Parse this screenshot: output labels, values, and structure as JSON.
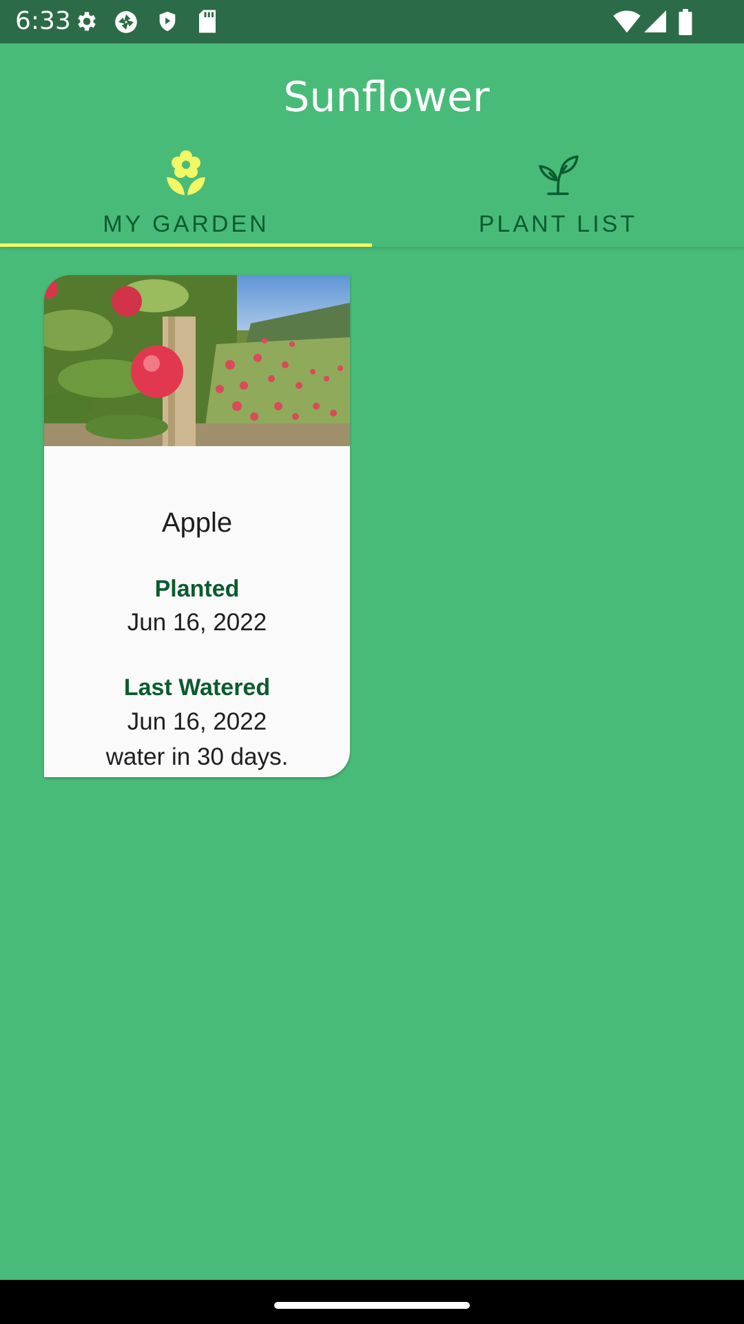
{
  "status_bar": {
    "time": "6:33",
    "left_icons": [
      "gear-icon",
      "aperture-icon",
      "shield-icon",
      "sd-card-icon"
    ],
    "right_icons": [
      "wifi-icon",
      "signal-icon",
      "battery-icon"
    ]
  },
  "app_bar": {
    "title": "Sunflower"
  },
  "tabs": [
    {
      "label": "MY GARDEN",
      "icon": "flower-icon",
      "selected": true
    },
    {
      "label": "PLANT LIST",
      "icon": "sprout-icon",
      "selected": false
    }
  ],
  "garden": {
    "plants": [
      {
        "name": "Apple",
        "planted_label": "Planted",
        "planted_date": "Jun 16, 2022",
        "watered_label": "Last Watered",
        "watered_date": "Jun 16, 2022",
        "water_interval": "water in 30 days."
      }
    ]
  },
  "colors": {
    "background": "#49BB79",
    "status_bar": "#2C6B47",
    "accent_yellow": "#F2F763",
    "dark_green_text": "#0B5B2F",
    "card": "#FAFAFA"
  }
}
